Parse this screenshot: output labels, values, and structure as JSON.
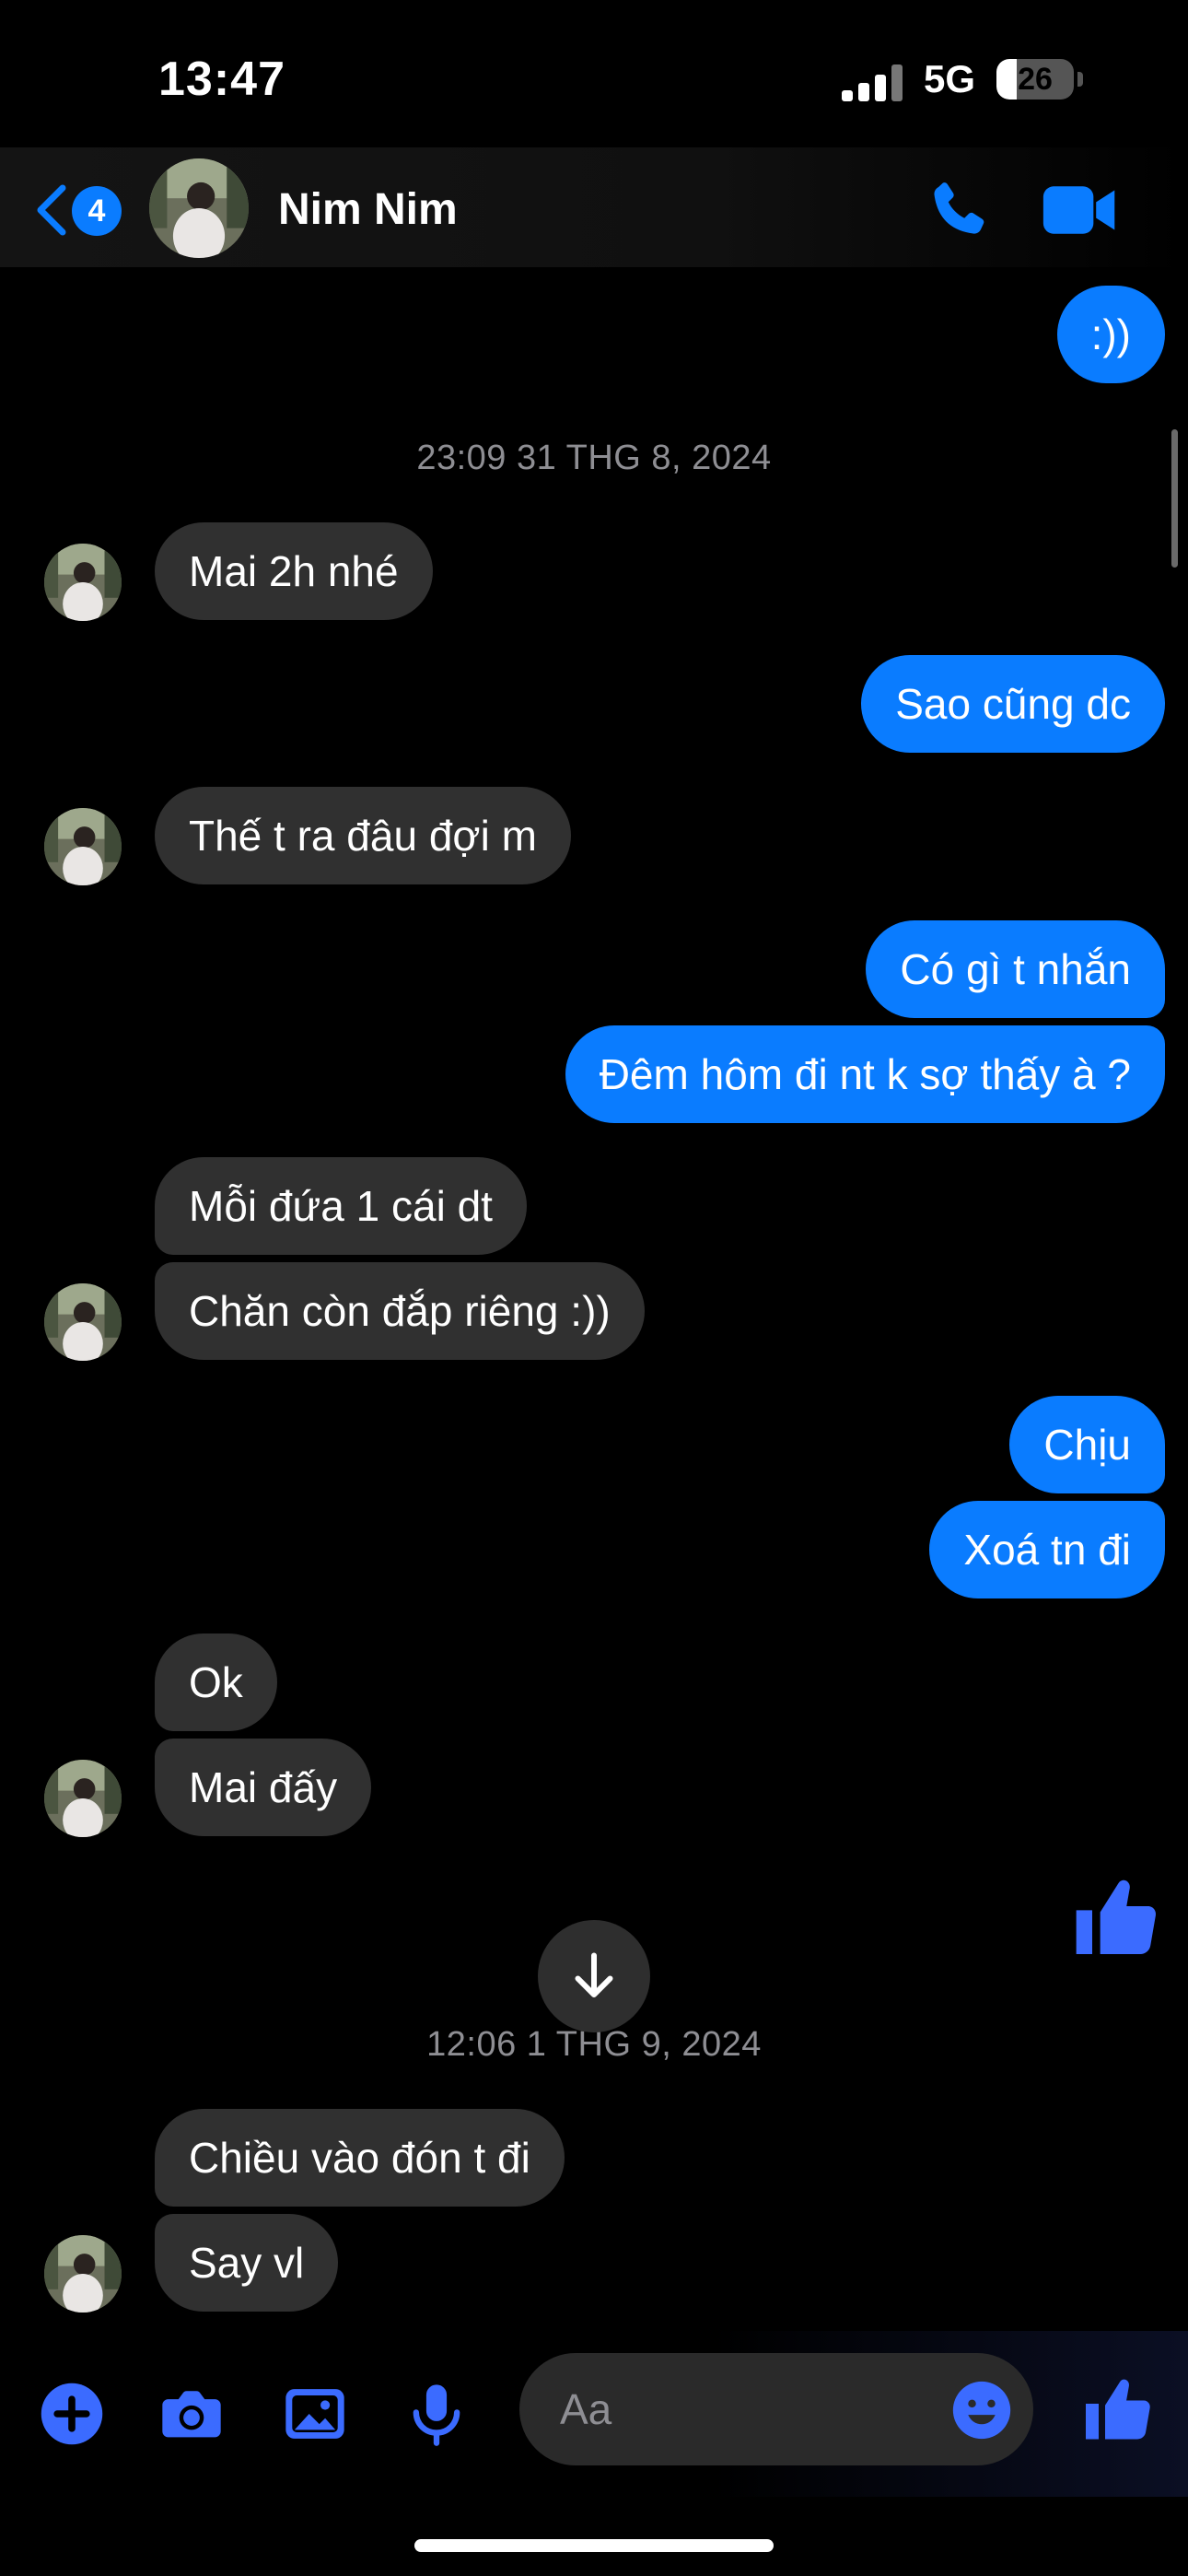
{
  "status_bar": {
    "time": "13:47",
    "network": "5G",
    "battery_level": "26",
    "battery_fraction": 0.26
  },
  "header": {
    "back_badge": "4",
    "contact_name": "Nim Nim",
    "call_icon": "phone-icon",
    "video_icon": "video-camera-icon",
    "accent_color": "#0a7cff"
  },
  "messages": {
    "m0": ":))",
    "stamp1": "23:09 31 THG 8, 2024",
    "m1": "Mai 2h nhé",
    "m2": "Sao cũng dc",
    "m3": "Thế t ra đâu đợi m",
    "m4": "Có gì t nhắn",
    "m5": "Đêm hôm đi nt k sợ thấy à ?",
    "m6": "Mỗi đứa 1 cái dt",
    "m7": "Chăn còn đắp riêng :))",
    "m8": "Chịu",
    "m9": "Xoá tn đi",
    "m10": "Ok",
    "m11": "Mai đấy",
    "m12_icon": "thumbs-up-icon",
    "stamp2": "12:06 1 THG 9, 2024",
    "m13": "Chiều vào đón t đi",
    "m14": "Say vl"
  },
  "composer": {
    "placeholder": "Aa",
    "icons": [
      "plus-icon",
      "camera-icon",
      "image-icon",
      "microphone-icon",
      "emoji-icon",
      "thumbs-up-icon"
    ]
  },
  "colors": {
    "incoming_bubble": "#303030",
    "outgoing_bubble": "#0a7cff",
    "timestamp": "#8e8e93",
    "background": "#000000"
  }
}
